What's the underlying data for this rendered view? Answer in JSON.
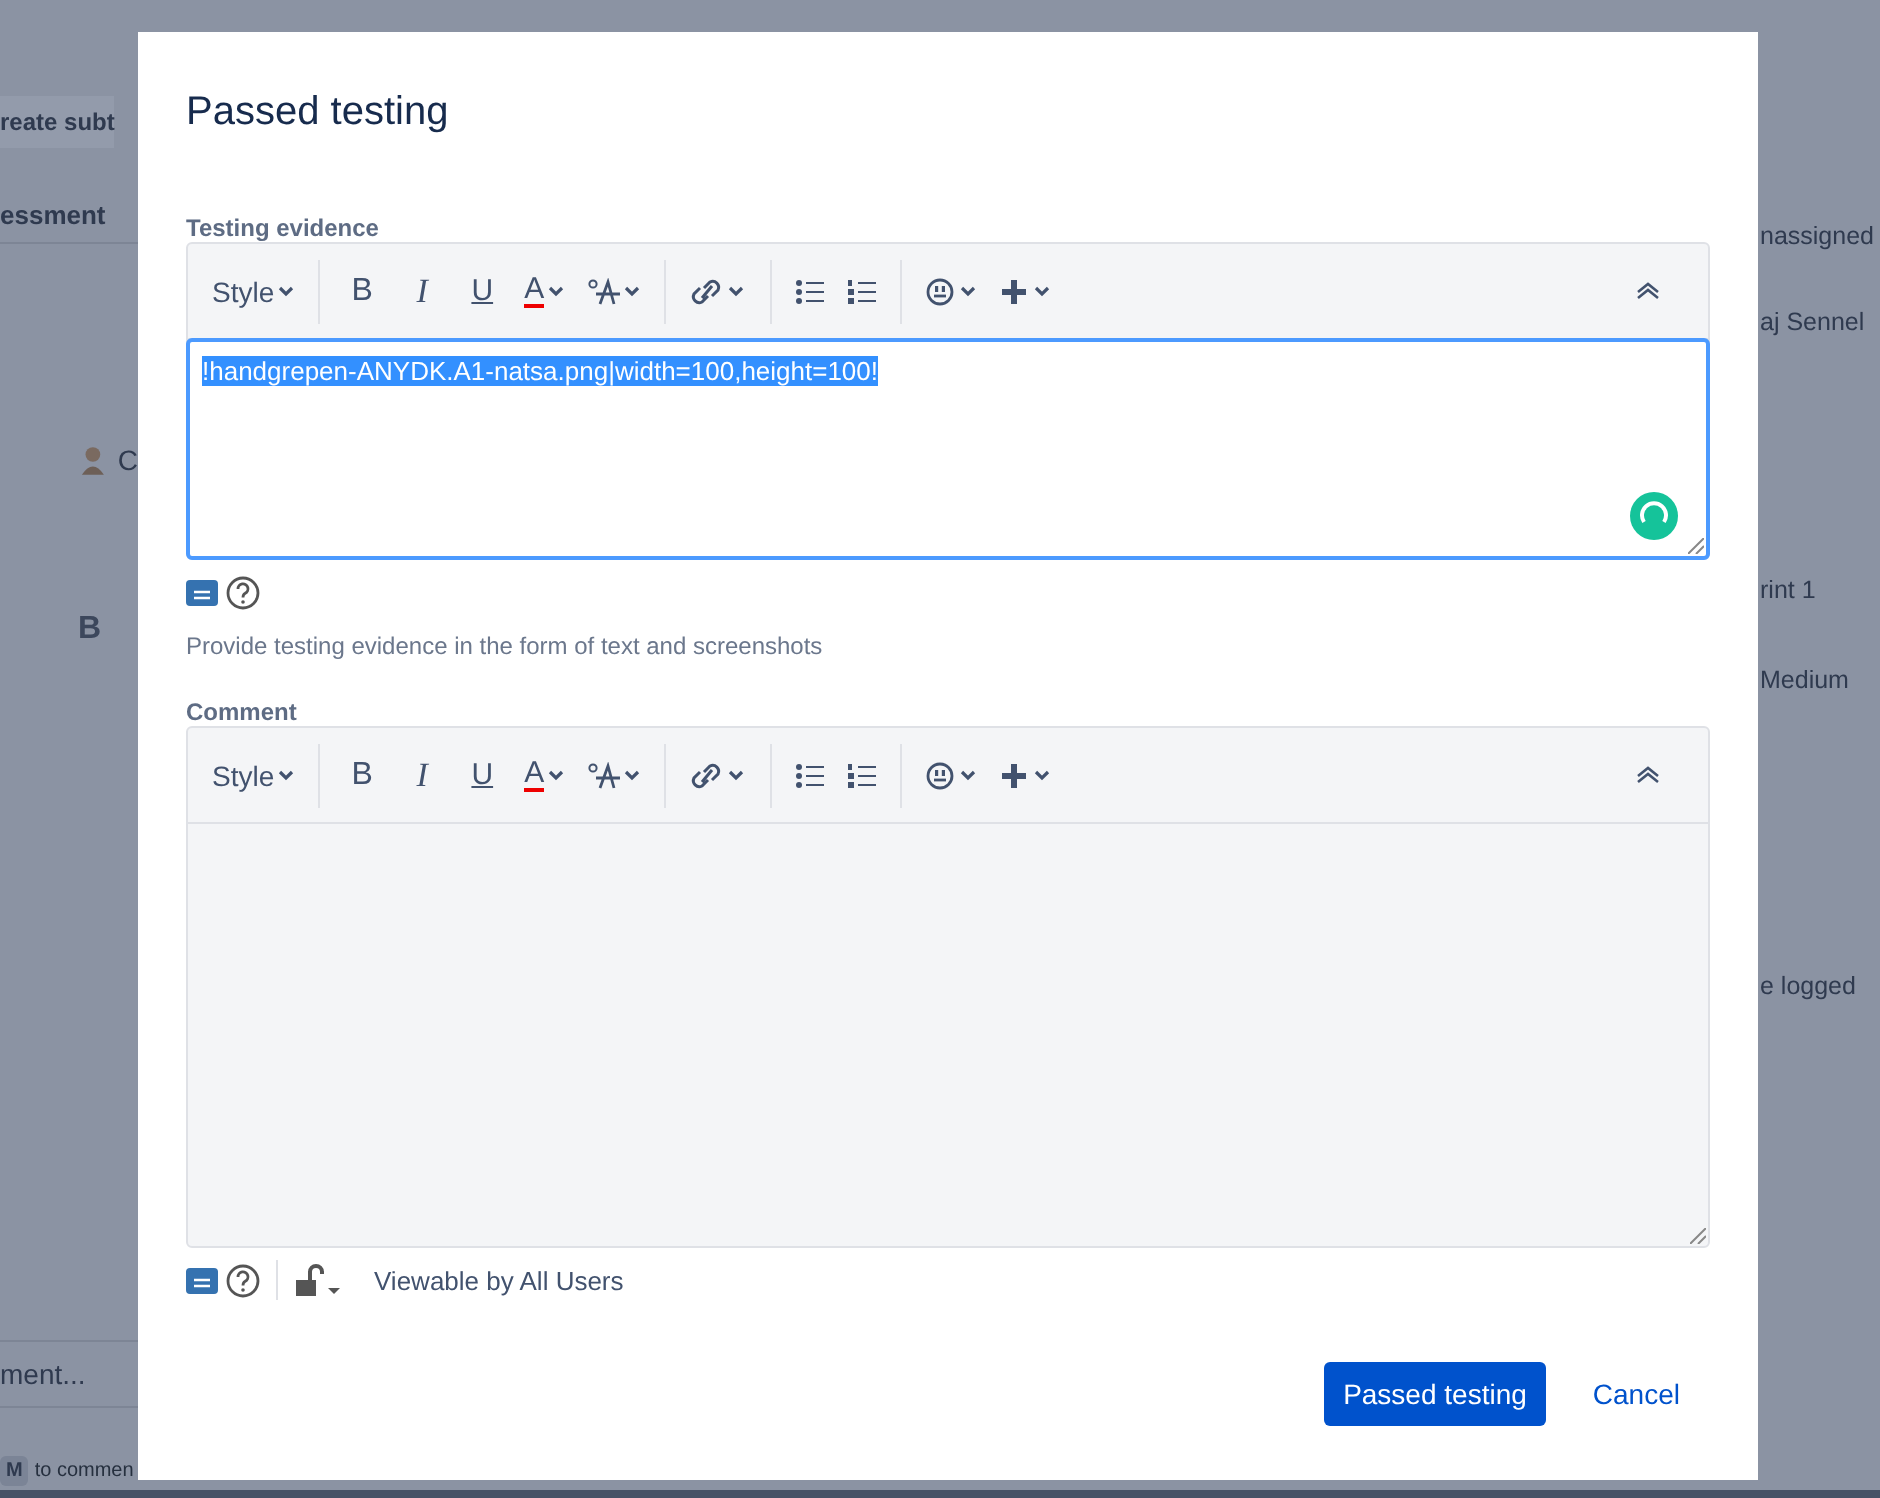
{
  "background": {
    "left": [
      {
        "kind": "button",
        "text": "reate subt"
      },
      {
        "kind": "tab",
        "text": "essment"
      },
      {
        "kind": "person",
        "text": "C"
      },
      {
        "kind": "bold",
        "text": "B"
      },
      {
        "kind": "input",
        "text": "ment..."
      },
      {
        "kind": "key",
        "key": "M",
        "text": "to commen"
      }
    ],
    "right": [
      {
        "text": "nassigned"
      },
      {
        "text": "aj Sennel"
      },
      {
        "text": "rint 1"
      },
      {
        "text": "Medium"
      },
      {
        "text": "e logged"
      }
    ]
  },
  "dialog": {
    "title": "Passed testing",
    "fields": [
      {
        "label": "Testing evidence",
        "focused": true,
        "value": "!handgrepen-ANYDK.A1-natsa.png|width=100,height=100!",
        "text_selected": true,
        "status_indicator": true,
        "hint": "Provide testing evidence in the form of text and screenshots",
        "toolbar": [
          [
            {
              "kind": "dropdown",
              "label": "Style"
            }
          ],
          [
            {
              "kind": "bold",
              "label": "B"
            },
            {
              "kind": "italic",
              "label": "I"
            },
            {
              "kind": "underline",
              "label": "U"
            },
            {
              "kind": "color",
              "label": "A"
            },
            {
              "kind": "size"
            }
          ],
          [
            {
              "kind": "link"
            }
          ],
          [
            {
              "kind": "bullets"
            },
            {
              "kind": "numbers"
            }
          ],
          [
            {
              "kind": "emoji"
            },
            {
              "kind": "insert"
            }
          ]
        ]
      },
      {
        "label": "Comment",
        "focused": false,
        "status_indicator": false,
        "visibility": "Viewable by All Users",
        "toolbar": [
          [
            {
              "kind": "dropdown",
              "label": "Style"
            }
          ],
          [
            {
              "kind": "bold",
              "label": "B"
            },
            {
              "kind": "italic",
              "label": "I"
            },
            {
              "kind": "underline",
              "label": "U"
            },
            {
              "kind": "color",
              "label": "A"
            },
            {
              "kind": "size"
            }
          ],
          [
            {
              "kind": "link"
            }
          ],
          [
            {
              "kind": "bullets"
            },
            {
              "kind": "numbers"
            }
          ],
          [
            {
              "kind": "emoji"
            },
            {
              "kind": "insert"
            }
          ]
        ]
      }
    ],
    "buttons": [
      {
        "kind": "primary",
        "label": "Passed testing"
      },
      {
        "kind": "link",
        "label": "Cancel"
      }
    ]
  }
}
